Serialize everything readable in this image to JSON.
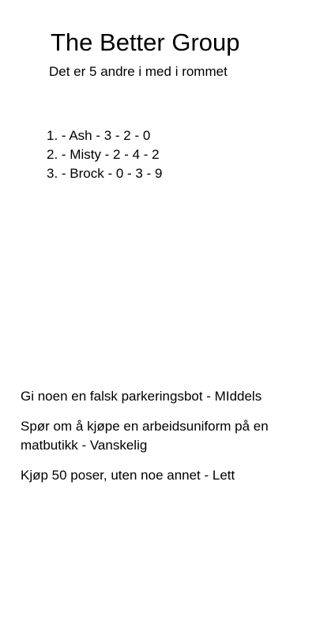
{
  "header": {
    "title": "The Better Group",
    "subtitle": "Det er 5 andre i med i rommet"
  },
  "standings": [
    "1. - Ash - 3 - 2 - 0",
    "2. - Misty - 2 - 4 - 2",
    "3. - Brock - 0 - 3 - 9"
  ],
  "challenges": [
    "Gi noen en falsk parkeringsbot - MIddels",
    "Spør om å kjøpe en arbeidsuniform på en matbutikk - Vanskelig",
    "Kjøp 50 poser, uten noe annet - Lett"
  ]
}
